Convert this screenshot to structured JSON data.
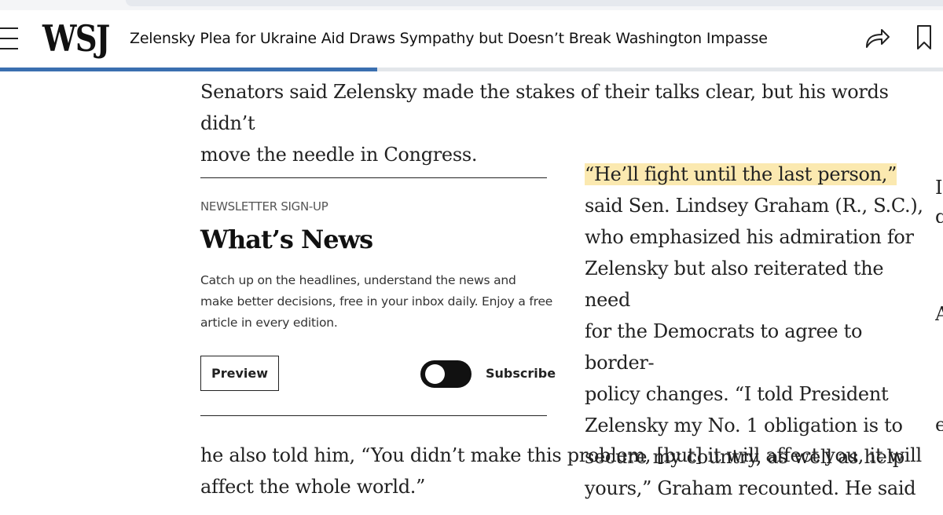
{
  "header": {
    "logo": "WSJ",
    "headline": "Zelensky Plea for Ukraine Aid Draws Sympathy but Doesn’t Break Washington Impasse",
    "icons": [
      "menu-icon",
      "share-icon",
      "bookmark-icon"
    ]
  },
  "progress": {
    "fraction": 0.4
  },
  "article": {
    "para1_line1": "Senators said Zelensky made the stakes of their talks clear, but his words didn’t",
    "para1_line2": "move the needle in Congress.",
    "quote_highlight": "“He’ll fight until the last person,”",
    "side_lines": [
      "said Sen. Lindsey Graham (R., S.C.),",
      "who emphasized his admiration for",
      "Zelensky but also reiterated the need",
      "for the Democrats to agree to border-",
      "policy changes. “I told President",
      "Zelensky my No. 1 obligation is to",
      "secure my country, as well as help",
      "yours,” Graham recounted. He said"
    ],
    "bottom_line1": "he also told him, “You didn’t make this problem, [but] it will affect you, it will",
    "bottom_line2": "affect the whole world.”"
  },
  "newsletter": {
    "kicker": "NEWSLETTER SIGN-UP",
    "title": "What’s News",
    "description_lines": [
      "Catch up on the headlines, understand the news and",
      "make better decisions, free in your inbox daily. Enjoy a free",
      "article in every edition."
    ],
    "preview_label": "Preview",
    "subscribe_label": "Subscribe",
    "subscribe_toggle_on": false
  },
  "colors": {
    "progress": "#3a6fb0",
    "highlight": "#fbe9b0",
    "toggle": "#111111"
  }
}
